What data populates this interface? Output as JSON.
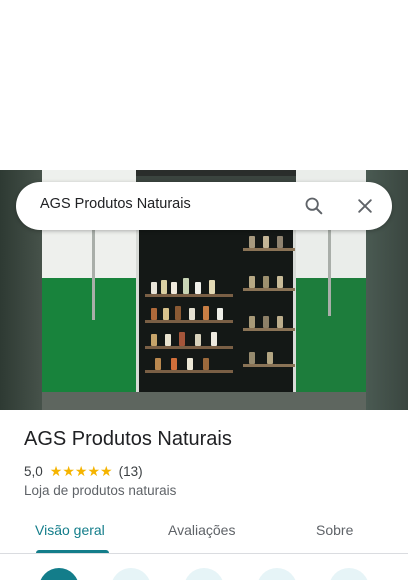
{
  "search": {
    "query": "AGS Produtos Naturais",
    "search_icon": "search-icon",
    "close_icon": "close-icon"
  },
  "place": {
    "name": "AGS Produtos Naturais",
    "rating": "5,0",
    "stars": 5,
    "review_count": "(13)",
    "category": "Loja de produtos naturais"
  },
  "tabs": [
    {
      "label": "Visão geral",
      "active": true
    },
    {
      "label": "Avaliações",
      "active": false
    },
    {
      "label": "Sobre",
      "active": false
    }
  ],
  "colors": {
    "accent": "#137d8a",
    "star": "#f5b400",
    "storefront_green": "#18833c"
  }
}
